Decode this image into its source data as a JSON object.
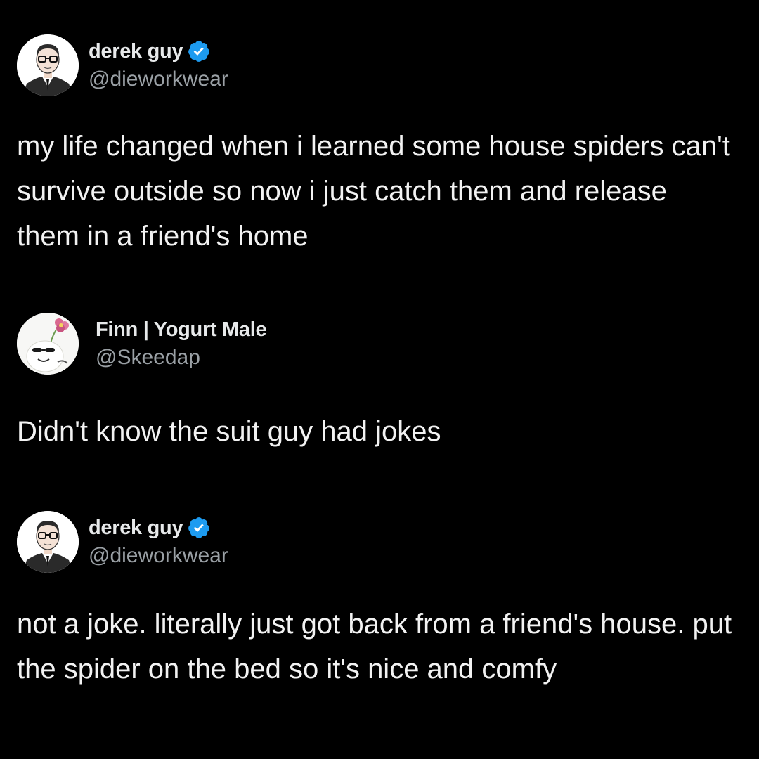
{
  "tweets": [
    {
      "author": {
        "display_name": "derek guy",
        "handle": "@dieworkwear",
        "verified": true,
        "avatar_icon": "man-with-glasses-sketch-avatar"
      },
      "text": "my life changed when i learned some house spiders can't survive outside so now i just catch them and release them in a friend's home"
    },
    {
      "author": {
        "display_name": "Finn | Yogurt Male",
        "handle": "@Skeedap",
        "verified": false,
        "avatar_icon": "cartoon-flower-character-avatar"
      },
      "text": "Didn't know the suit guy had jokes"
    },
    {
      "author": {
        "display_name": "derek guy",
        "handle": "@dieworkwear",
        "verified": true,
        "avatar_icon": "man-with-glasses-sketch-avatar"
      },
      "text": "not a joke. literally just got back from a friend's house. put the spider on the bed so it's nice and comfy"
    }
  ],
  "colors": {
    "background": "#000000",
    "name": "#e7e9ea",
    "handle": "#9aa0a5",
    "verified_blue": "#1d9bf0"
  }
}
